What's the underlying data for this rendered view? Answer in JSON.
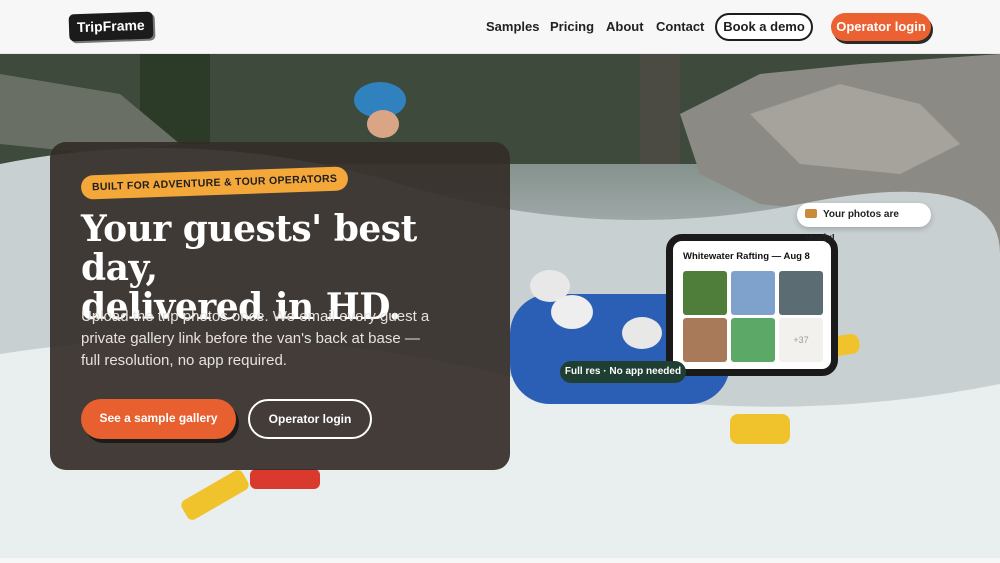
{
  "brand": {
    "name": "TripFrame"
  },
  "nav": {
    "links": [
      "Samples",
      "Pricing",
      "About",
      "Contact"
    ],
    "book_demo": "Book a demo",
    "operator_login": "Operator login"
  },
  "hero": {
    "eyebrow": "BUILT FOR ADVENTURE & TOUR OPERATORS",
    "headline_line1": "Your guests' best day,",
    "headline_line2": "delivered in HD.",
    "subtitle": "Upload the trip photos once. We email every guest a private gallery link before the van's back at base — full resolution, no app required.",
    "cta_primary": "See a sample gallery",
    "cta_secondary": "Operator login",
    "background_scene": "whitewater rafting photo"
  },
  "gallery_card": {
    "toast": "Your photos are ready!",
    "toast_icon": "photo-icon",
    "title": "Whitewater Rafting — Aug 8",
    "more_count": "+37",
    "badge": "Full res · No app needed"
  },
  "colors": {
    "accent": "#ec6131",
    "eyebrow": "#f5a83a",
    "card_bg": "#342d28",
    "badge_bg": "#1f3f33"
  }
}
